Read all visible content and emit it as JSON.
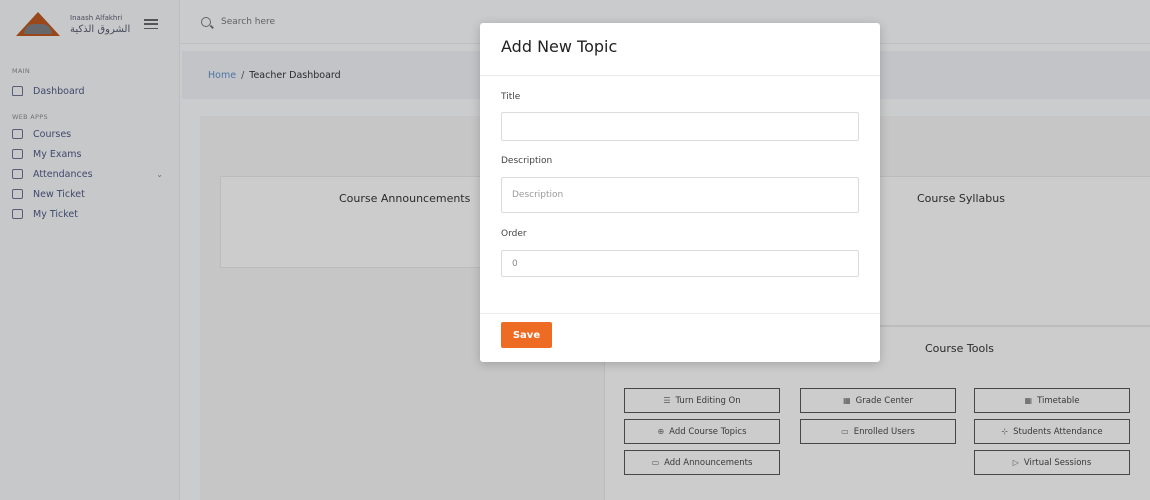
{
  "brand": {
    "name_en": "Inaash Alfakhri",
    "name_ar": "الشروق الذكية"
  },
  "search": {
    "placeholder": "Search here"
  },
  "sidebar": {
    "section_main": "MAIN",
    "section_apps": "WEB APPS",
    "items": [
      {
        "label": "Dashboard",
        "icon": "home-icon"
      },
      {
        "label": "Courses",
        "icon": "book-icon"
      },
      {
        "label": "My Exams",
        "icon": "file-icon"
      },
      {
        "label": "Attendances",
        "icon": "calendar-icon"
      },
      {
        "label": "New Ticket",
        "icon": "ticket-icon"
      },
      {
        "label": "My Ticket",
        "icon": "list-icon"
      }
    ]
  },
  "breadcrumb": {
    "home": "Home",
    "separator": "/",
    "current": "Teacher Dashboard"
  },
  "cards": {
    "announcements_title": "Course Announcements",
    "syllabus_title": "Course Syllabus",
    "tools_title": "Course Tools"
  },
  "tools": [
    {
      "label": "Turn Editing On",
      "icon": "edit-icon"
    },
    {
      "label": "Grade Center",
      "icon": "grid-icon"
    },
    {
      "label": "Timetable",
      "icon": "table-icon"
    },
    {
      "label": "Add Course Topics",
      "icon": "plus-icon"
    },
    {
      "label": "Enrolled Users",
      "icon": "users-icon"
    },
    {
      "label": "Students Attendance",
      "icon": "attendance-icon"
    },
    {
      "label": "Add Announcements",
      "icon": "calendar-icon"
    },
    {
      "label": "Virtual Sessions",
      "icon": "video-icon"
    }
  ],
  "modal": {
    "title": "Add New Topic",
    "title_label": "Title",
    "title_value": "",
    "description_label": "Description",
    "description_placeholder": "Description",
    "order_label": "Order",
    "order_value": "0",
    "save_label": "Save"
  },
  "colors": {
    "accent": "#ee6b24",
    "brand": "#b8551f",
    "link": "#5b8dc6"
  }
}
